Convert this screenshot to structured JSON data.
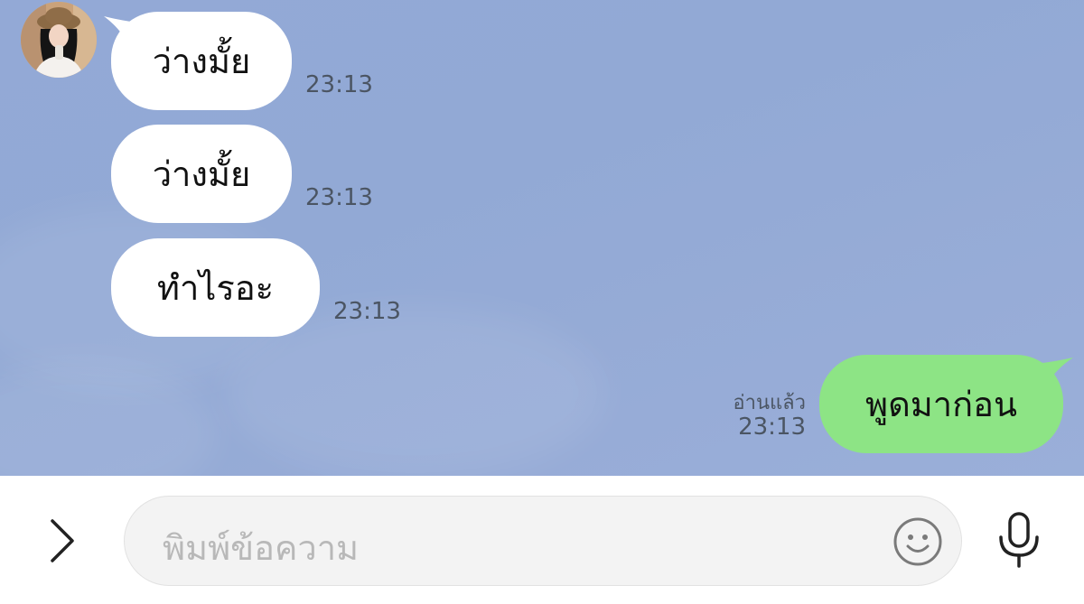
{
  "messages": [
    {
      "direction": "incoming",
      "text": "ว่างมั้ย",
      "time": "23:13"
    },
    {
      "direction": "incoming",
      "text": "ว่างมั้ย",
      "time": "23:13"
    },
    {
      "direction": "incoming",
      "text": "ทำไรอะ",
      "time": "23:13"
    },
    {
      "direction": "outgoing",
      "text": "พูดมาก่อน",
      "time": "23:13",
      "read_label": "อ่านแล้ว"
    }
  ],
  "input": {
    "placeholder": "พิมพ์ข้อความ"
  },
  "icons": {
    "expand": "chevron-right-icon",
    "emoji": "smiley-icon",
    "mic": "microphone-icon"
  },
  "colors": {
    "chat_background": "#93a9d6",
    "incoming_bubble": "#ffffff",
    "outgoing_bubble": "#8de485",
    "input_field": "#f3f3f3"
  }
}
